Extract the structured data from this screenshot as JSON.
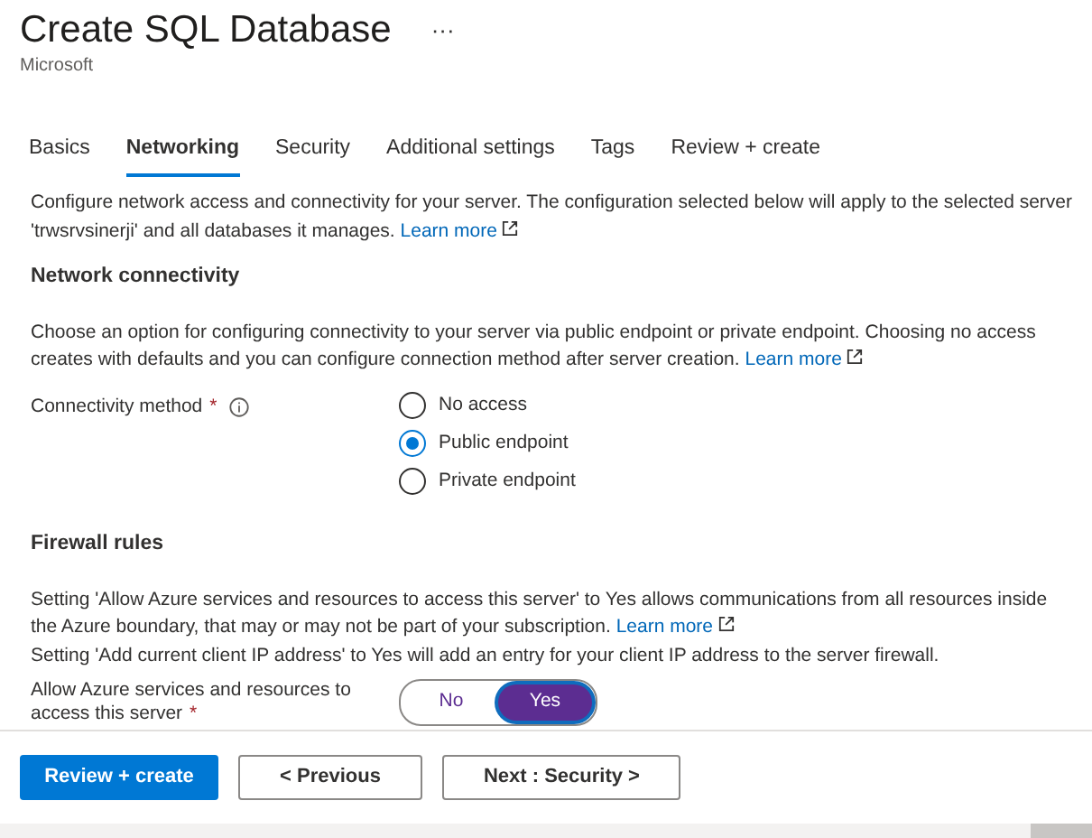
{
  "header": {
    "title": "Create SQL Database",
    "more": "···",
    "publisher": "Microsoft"
  },
  "tabs": [
    {
      "label": "Basics",
      "selected": false
    },
    {
      "label": "Networking",
      "selected": true
    },
    {
      "label": "Security",
      "selected": false
    },
    {
      "label": "Additional settings",
      "selected": false
    },
    {
      "label": "Tags",
      "selected": false
    },
    {
      "label": "Review + create",
      "selected": false
    }
  ],
  "intro": {
    "text": "Configure network access and connectivity for your server. The configuration selected below will apply to the selected server 'trwsrvsinerji' and all databases it manages.",
    "link": "Learn more"
  },
  "network_connectivity": {
    "heading": "Network connectivity",
    "text": "Choose an option for configuring connectivity to your server via public endpoint or private endpoint. Choosing no access creates with defaults and you can configure connection method after server creation.",
    "link": "Learn more",
    "field": {
      "label": "Connectivity method",
      "required_mark": "*",
      "options": [
        {
          "label": "No access",
          "selected": false
        },
        {
          "label": "Public endpoint",
          "selected": true
        },
        {
          "label": "Private endpoint",
          "selected": false
        }
      ]
    }
  },
  "firewall_rules": {
    "heading": "Firewall rules",
    "text": "Setting 'Allow Azure services and resources to access this server' to Yes allows communications from all resources inside the Azure boundary, that may or may not be part of your subscription.",
    "link": "Learn more",
    "text_2": "Setting 'Add current client IP address' to Yes will add an entry for your client IP address to the server firewall.",
    "field": {
      "label": "Allow Azure services and resources to access this server",
      "required_mark": "*",
      "options": [
        {
          "label": "No",
          "selected": false
        },
        {
          "label": "Yes",
          "selected": true
        }
      ]
    }
  },
  "footer": {
    "buttons": [
      {
        "label": "Review + create",
        "kind": "primary"
      },
      {
        "label": "< Previous",
        "kind": "secondary"
      },
      {
        "label": "Next : Security >",
        "kind": "secondary"
      }
    ]
  }
}
